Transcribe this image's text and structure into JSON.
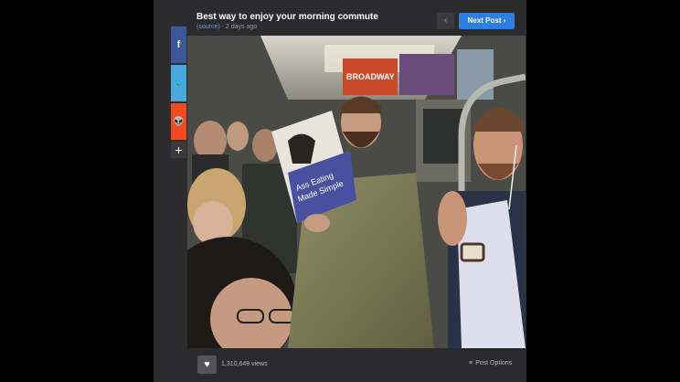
{
  "post": {
    "title": "Best way to enjoy your morning commute",
    "source_label": "(source)",
    "separator": " · ",
    "time_ago": "2 days ago"
  },
  "nav": {
    "prev_glyph": "‹",
    "next_label": "Next Post",
    "next_glyph": "›"
  },
  "share": {
    "facebook_glyph": "f",
    "twitter_glyph": "🐦",
    "reddit_glyph": "👽",
    "more_glyph": "+"
  },
  "image": {
    "book_title_line1": "Ass Eating",
    "book_title_line2": "Made Simple",
    "sign_text": "BROADWAY"
  },
  "footer": {
    "like_glyph": "♥",
    "views": "1,310,649 views",
    "options_glyph": "≡",
    "options_label": "Post Options"
  }
}
